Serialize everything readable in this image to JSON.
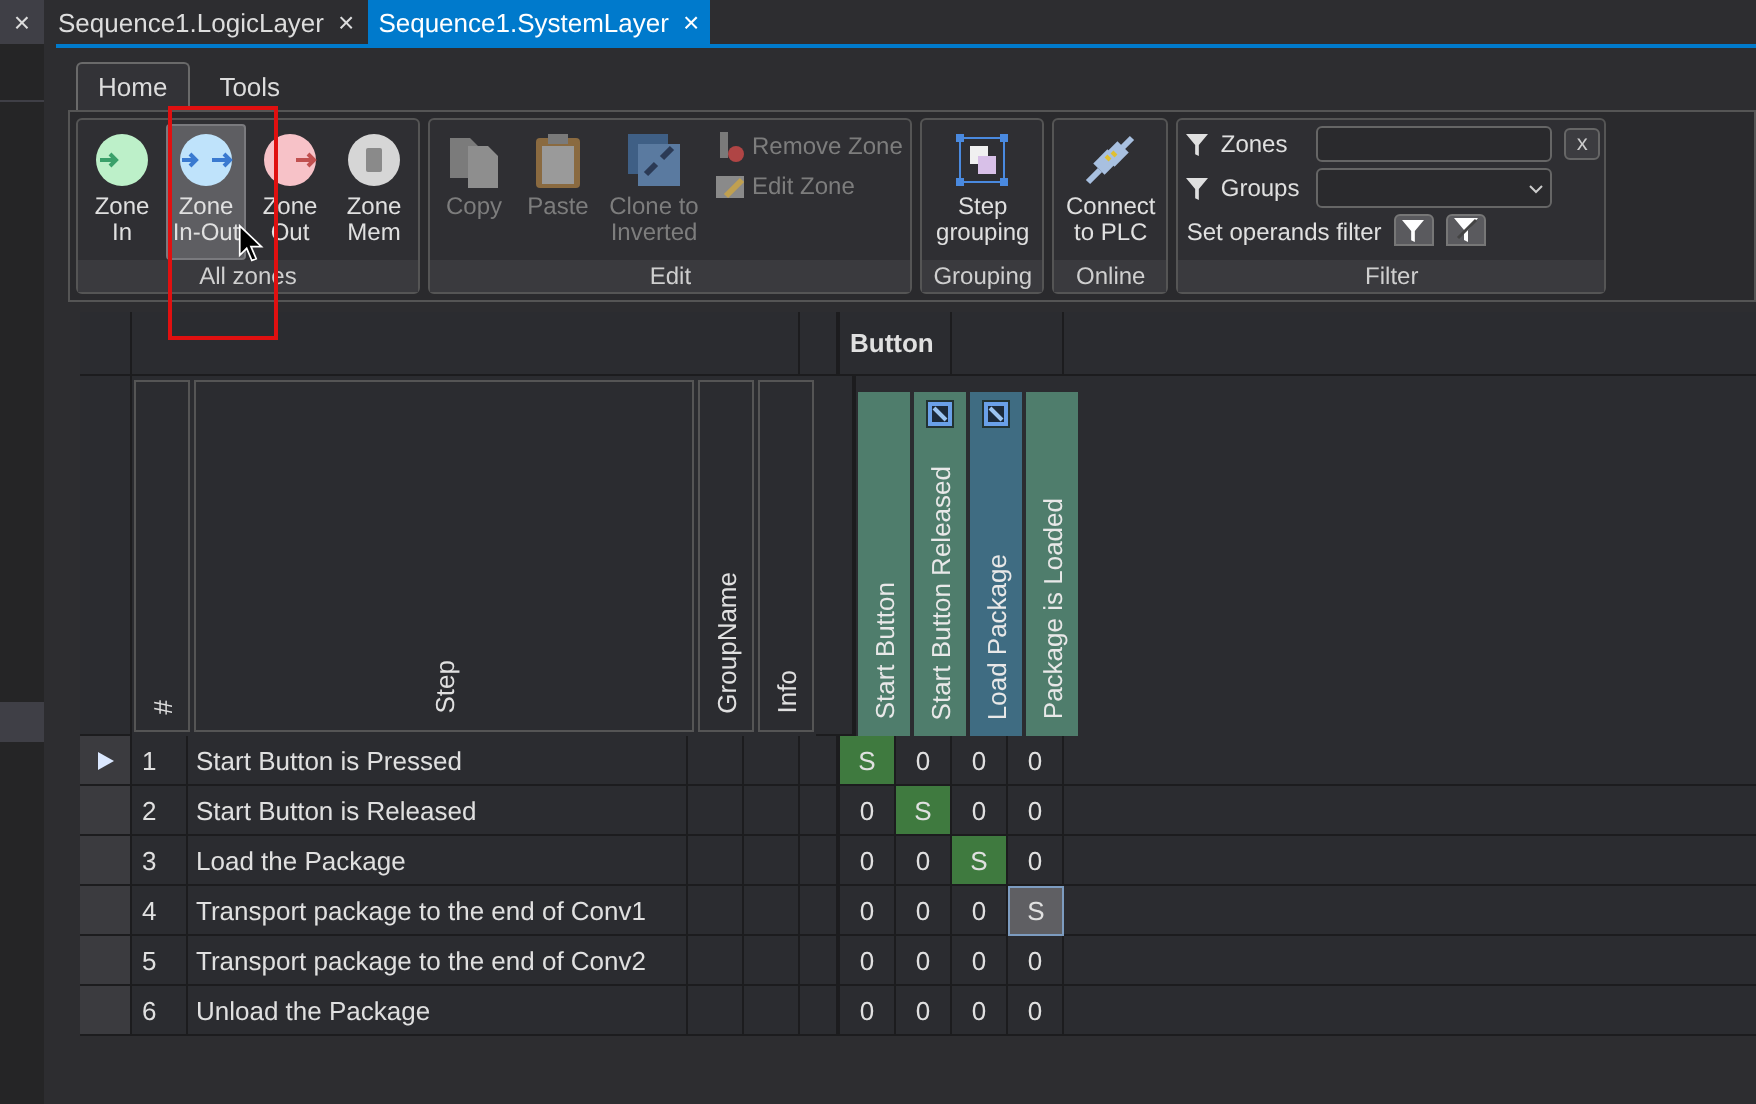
{
  "side_panel": {
    "close": "×"
  },
  "tabs": [
    {
      "label": "Sequence1.LogicLayer",
      "close": "×",
      "selected": false
    },
    {
      "label": "Sequence1.SystemLayer",
      "close": "×",
      "selected": true
    }
  ],
  "ribbon": {
    "tabs": [
      {
        "label": "Home",
        "selected": true
      },
      {
        "label": "Tools",
        "selected": false
      }
    ],
    "zones_group": {
      "label": "All zones",
      "buttons": [
        {
          "label": "Zone In",
          "kind": "in",
          "color": "#bdf0c9",
          "selected": false
        },
        {
          "label": "Zone In-Out",
          "kind": "inout",
          "color": "#bfe3fb",
          "selected": true
        },
        {
          "label": "Zone Out",
          "kind": "out",
          "color": "#f7c2c8",
          "selected": false
        },
        {
          "label": "Zone Mem",
          "kind": "mem",
          "color": "#d6d6d6",
          "selected": false
        }
      ]
    },
    "edit_group": {
      "label": "Edit",
      "buttons": [
        {
          "label": "Copy",
          "kind": "copy",
          "disabled": true
        },
        {
          "label": "Paste",
          "kind": "paste",
          "disabled": true
        },
        {
          "label": "Clone to Inverted",
          "kind": "clone",
          "disabled": true
        }
      ],
      "small_buttons": [
        {
          "label": "Remove Zone",
          "kind": "remove",
          "disabled": true
        },
        {
          "label": "Edit Zone",
          "kind": "edit",
          "disabled": true
        }
      ]
    },
    "grouping_group": {
      "label": "Grouping",
      "button": "Step grouping"
    },
    "online_group": {
      "label": "Online",
      "button": "Connect to PLC"
    },
    "filter_group": {
      "label": "Filter",
      "zones": {
        "label": "Zones",
        "clear": "x"
      },
      "groups": {
        "label": "Groups"
      },
      "operands_filter": {
        "label": "Set operands filter"
      }
    }
  },
  "grid": {
    "band": "Button",
    "columns": [
      "#",
      "Step",
      "GroupName",
      "Info"
    ],
    "operands": [
      {
        "name": "Start Button",
        "color": "#4f7d6c",
        "linked": false
      },
      {
        "name": "Start Button Released",
        "color": "#4f7d6c",
        "linked": true
      },
      {
        "name": "Load Package",
        "color": "#3f6c82",
        "linked": true
      },
      {
        "name": "Package is Loaded",
        "color": "#4f7d6c",
        "linked": false
      }
    ],
    "rows": [
      {
        "number": "1",
        "step": "Start Button is Pressed",
        "current": true,
        "cells": [
          {
            "value": "S",
            "active": true,
            "selected": false
          },
          {
            "value": "0",
            "active": false,
            "selected": false
          },
          {
            "value": "0",
            "active": false,
            "selected": false
          },
          {
            "value": "0",
            "active": false,
            "selected": false
          }
        ]
      },
      {
        "number": "2",
        "step": "Start Button is Released",
        "current": false,
        "cells": [
          {
            "value": "0",
            "active": false,
            "selected": false
          },
          {
            "value": "S",
            "active": true,
            "selected": false
          },
          {
            "value": "0",
            "active": false,
            "selected": false
          },
          {
            "value": "0",
            "active": false,
            "selected": false
          }
        ]
      },
      {
        "number": "3",
        "step": "Load the Package",
        "current": false,
        "cells": [
          {
            "value": "0",
            "active": false,
            "selected": false
          },
          {
            "value": "0",
            "active": false,
            "selected": false
          },
          {
            "value": "S",
            "active": true,
            "selected": false
          },
          {
            "value": "0",
            "active": false,
            "selected": false
          }
        ]
      },
      {
        "number": "4",
        "step": "Transport package to the end of Conv1",
        "current": false,
        "cells": [
          {
            "value": "0",
            "active": false,
            "selected": false
          },
          {
            "value": "0",
            "active": false,
            "selected": false
          },
          {
            "value": "0",
            "active": false,
            "selected": false
          },
          {
            "value": "S",
            "active": false,
            "selected": true
          }
        ]
      },
      {
        "number": "5",
        "step": "Transport package to the end of Conv2",
        "current": false,
        "cells": [
          {
            "value": "0",
            "active": false,
            "selected": false
          },
          {
            "value": "0",
            "active": false,
            "selected": false
          },
          {
            "value": "0",
            "active": false,
            "selected": false
          },
          {
            "value": "0",
            "active": false,
            "selected": false
          }
        ]
      },
      {
        "number": "6",
        "step": "Unload the Package",
        "current": false,
        "cells": [
          {
            "value": "0",
            "active": false,
            "selected": false
          },
          {
            "value": "0",
            "active": false,
            "selected": false
          },
          {
            "value": "0",
            "active": false,
            "selected": false
          },
          {
            "value": "0",
            "active": false,
            "selected": false
          }
        ]
      }
    ]
  }
}
